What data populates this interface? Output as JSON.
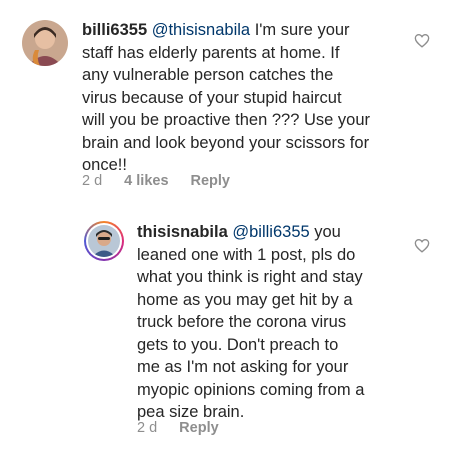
{
  "comments": [
    {
      "username": "billi6355",
      "mention": "@thisisnabila",
      "body": " I'm sure your\nstaff has elderly parents at home. If\nany vulnerable person catches the\nvirus because of your stupid haircut\nwill you be proactive then ??? Use your\nbrain and look beyond your scissors for\nonce!!",
      "time": "2 d",
      "likes": "4 likes",
      "reply_label": "Reply"
    },
    {
      "username": "thisisnabila",
      "mention": "@billi6355",
      "body": " you\nleaned one with 1 post,  pls do\nwhat you think is right and stay\nhome as you may get hit by a\ntruck before the corona virus\ngets to you. Don't preach to\nme as I'm not asking for your\nmyopic opinions coming from a\npea size brain.",
      "time": "2 d",
      "reply_label": "Reply"
    }
  ],
  "icons": {
    "like": "heart-outline-icon"
  },
  "colors": {
    "mention": "#00376b",
    "meta": "#8e8e8e",
    "ring": "#dd2a7b"
  }
}
